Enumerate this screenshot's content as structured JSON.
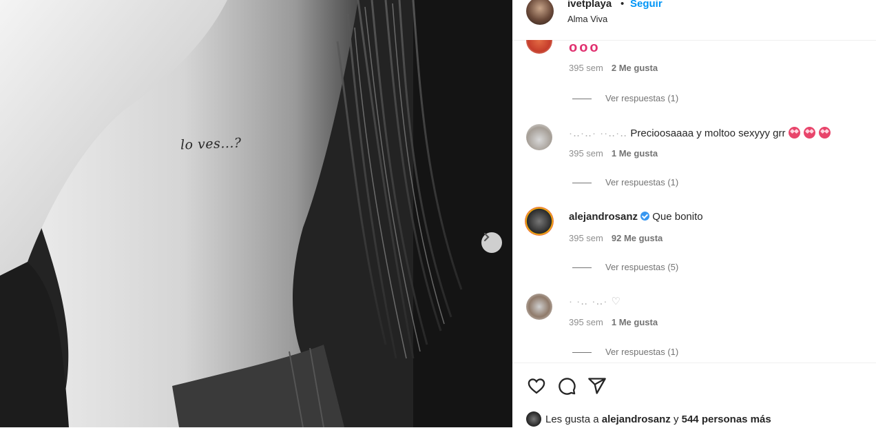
{
  "post": {
    "username": "ivetplaya",
    "separator": "•",
    "follow_label": "Seguir",
    "location": "Alma Viva",
    "tattoo_text": "lo ves...?"
  },
  "comments": [
    {
      "user": "",
      "text": "",
      "time": "395 sem",
      "likes": "2 Me gusta",
      "replies": "Ver respuestas (1)",
      "emoji": "kiss-mark-emoji x3"
    },
    {
      "user": "",
      "text": "Precioosaaaa y moltoo sexyyy grr",
      "time": "395 sem",
      "likes": "1 Me gusta",
      "replies": "Ver respuestas (1)",
      "emoji": "heart-eyes-emoji x3"
    },
    {
      "user": "alejandrosanz",
      "text": "Que bonito",
      "time": "395 sem",
      "likes": "92 Me gusta",
      "replies": "Ver respuestas (5)"
    },
    {
      "user": "",
      "text": "",
      "time": "395 sem",
      "likes": "1 Me gusta",
      "replies": "Ver respuestas (1)"
    }
  ],
  "footer": {
    "liked_prefix": "Les gusta a",
    "liked_user": "alejandrosanz",
    "liked_mid": "y",
    "liked_count": "544 personas más"
  },
  "colors": {
    "link": "#0095f6",
    "verified": "#3897f0",
    "secondary": "#8e8e8e"
  },
  "icons": [
    "chevron-right-icon",
    "heart-icon",
    "comment-icon",
    "share-icon",
    "verified-icon"
  ]
}
